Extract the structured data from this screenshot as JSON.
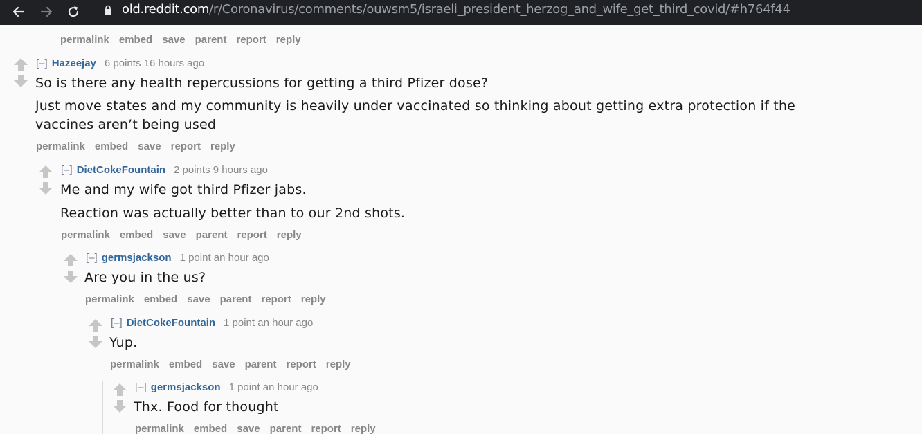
{
  "browser": {
    "url_host": "old.reddit.com",
    "url_path": "/r/Coronavirus/comments/ouwsm5/israeli_president_herzog_and_wife_get_third_covid/#h764f44"
  },
  "top_actions": [
    "permalink",
    "embed",
    "save",
    "parent",
    "report",
    "reply"
  ],
  "comments": [
    {
      "expand": "[–]",
      "author": "Hazeejay",
      "score": "6 points",
      "time": "16 hours ago",
      "paragraphs": [
        "So is there any health repercussions for getting a third Pfizer dose?",
        "Just move states and my community is heavily under vaccinated so thinking about getting extra protection if the",
        "vaccines aren’t being used"
      ],
      "actions": [
        "permalink",
        "embed",
        "save",
        "report",
        "reply"
      ]
    },
    {
      "expand": "[–]",
      "author": "DietCokeFountain",
      "score": "2 points",
      "time": "9 hours ago",
      "paragraphs": [
        "Me and my wife got third Pfizer jabs.",
        "Reaction was actually better than to our 2nd shots."
      ],
      "actions": [
        "permalink",
        "embed",
        "save",
        "parent",
        "report",
        "reply"
      ]
    },
    {
      "expand": "[–]",
      "author": "germsjackson",
      "score": "1 point",
      "time": "an hour ago",
      "paragraphs": [
        "Are you in the us?"
      ],
      "actions": [
        "permalink",
        "embed",
        "save",
        "parent",
        "report",
        "reply"
      ]
    },
    {
      "expand": "[–]",
      "author": "DietCokeFountain",
      "score": "1 point",
      "time": "an hour ago",
      "paragraphs": [
        "Yup."
      ],
      "actions": [
        "permalink",
        "embed",
        "save",
        "parent",
        "report",
        "reply"
      ]
    },
    {
      "expand": "[–]",
      "author": "germsjackson",
      "score": "1 point",
      "time": "an hour ago",
      "paragraphs": [
        "Thx. Food for thought"
      ],
      "actions": [
        "permalink",
        "embed",
        "save",
        "parent",
        "report",
        "reply"
      ]
    }
  ]
}
